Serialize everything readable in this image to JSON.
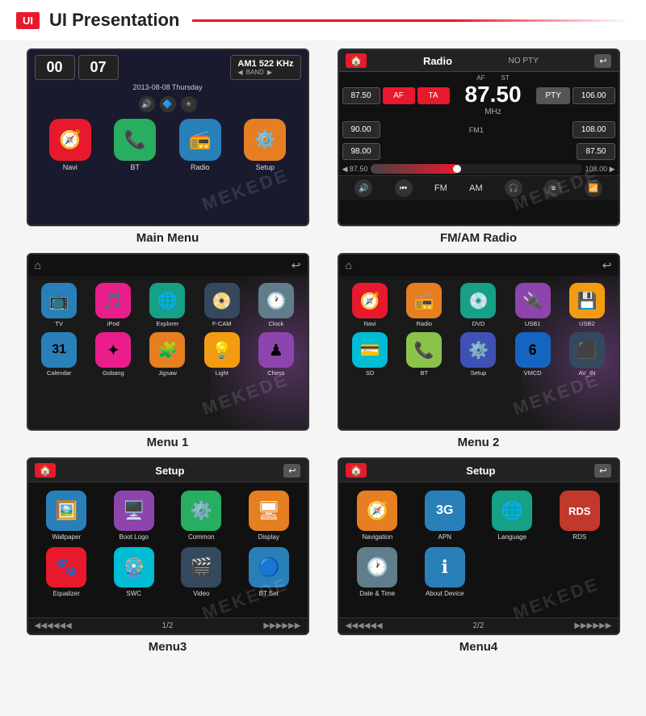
{
  "header": {
    "badge": "UI",
    "title": "UI Presentation"
  },
  "screens": [
    {
      "id": "main-menu",
      "label": "Main Menu",
      "data": {
        "time1": "00",
        "time2": "07",
        "radio_freq": "AM1 522 KHz",
        "band": "BAND",
        "date": "2013-08-08 Thursday",
        "apps": [
          {
            "label": "Navi",
            "icon": "🧭",
            "color": "ic-red"
          },
          {
            "label": "BT",
            "icon": "📞",
            "color": "ic-green"
          },
          {
            "label": "Radio",
            "icon": "📻",
            "color": "ic-blue"
          },
          {
            "label": "Setup",
            "icon": "⚙️",
            "color": "ic-orange"
          }
        ]
      }
    },
    {
      "id": "radio",
      "label": "FM/AM Radio",
      "data": {
        "title": "Radio",
        "no_pty": "NO PTY",
        "freq_main": "87.50",
        "mhz": "MHz",
        "fm1": "FM1",
        "af_label": "AF",
        "st_label": "ST",
        "btns": [
          "87.50",
          "AF",
          "TA",
          "PTY",
          "106.00"
        ],
        "btns2": [
          "90.00",
          "",
          "",
          "",
          "108.00"
        ],
        "btns3": [
          "98.00",
          "",
          "",
          "",
          "87.50"
        ],
        "slider_left": "87.50",
        "slider_right": "108.00",
        "bottom": [
          "FM",
          "AM"
        ]
      }
    },
    {
      "id": "menu1",
      "label": "Menu 1",
      "data": {
        "apps_row1": [
          {
            "label": "TV",
            "icon": "📺",
            "color": "ic-blue"
          },
          {
            "label": "iPod",
            "icon": "🎵",
            "color": "ic-pink"
          },
          {
            "label": "Explorer",
            "icon": "🌐",
            "color": "ic-teal"
          },
          {
            "label": "F-CAM",
            "icon": "📀",
            "color": "ic-dark"
          },
          {
            "label": "Clock",
            "icon": "🕐",
            "color": "ic-gray"
          }
        ],
        "apps_row2": [
          {
            "label": "Calendar",
            "icon": "31",
            "color": "ic-blue"
          },
          {
            "label": "Gobang",
            "icon": "✦",
            "color": "ic-pink"
          },
          {
            "label": "Jigsaw",
            "icon": "🧩",
            "color": "ic-orange"
          },
          {
            "label": "Light",
            "icon": "💡",
            "color": "ic-yellow"
          },
          {
            "label": "Chess",
            "icon": "♟",
            "color": "ic-purple"
          }
        ]
      }
    },
    {
      "id": "menu2",
      "label": "Menu 2",
      "data": {
        "apps_row1": [
          {
            "label": "Navi",
            "icon": "🧭",
            "color": "ic-red"
          },
          {
            "label": "Radio",
            "icon": "📻",
            "color": "ic-orange"
          },
          {
            "label": "DVD",
            "icon": "💿",
            "color": "ic-teal"
          },
          {
            "label": "USB1",
            "icon": "🔌",
            "color": "ic-purple"
          },
          {
            "label": "USB2",
            "icon": "💾",
            "color": "ic-yellow"
          }
        ],
        "apps_row2": [
          {
            "label": "SD",
            "icon": "💳",
            "color": "ic-cyan"
          },
          {
            "label": "BT",
            "icon": "📞",
            "color": "ic-lime"
          },
          {
            "label": "Setup",
            "icon": "⚙️",
            "color": "ic-indigo"
          },
          {
            "label": "VMCD",
            "icon": "6",
            "color": "ic-deepblue"
          },
          {
            "label": "AV_IN",
            "icon": "⬛",
            "color": "ic-dark"
          }
        ]
      }
    },
    {
      "id": "setup1",
      "label": "Menu3",
      "data": {
        "title": "Setup",
        "page": "1/2",
        "apps": [
          {
            "label": "Wallpaper",
            "icon": "🖼️",
            "color": "ic-blue"
          },
          {
            "label": "Boot Logo",
            "icon": "🖥️",
            "color": "ic-purple"
          },
          {
            "label": "Common",
            "icon": "⚙️",
            "color": "ic-green"
          },
          {
            "label": "Display",
            "icon": "🖥",
            "color": "ic-orange"
          },
          {
            "label": "Equalizer",
            "icon": "🐾",
            "color": "ic-red"
          },
          {
            "label": "SWC",
            "icon": "🎡",
            "color": "ic-cyan"
          },
          {
            "label": "Video",
            "icon": "🎬",
            "color": "ic-dark"
          },
          {
            "label": "BT Set",
            "icon": "🔵",
            "color": "ic-blue"
          }
        ]
      }
    },
    {
      "id": "setup2",
      "label": "Menu4",
      "data": {
        "title": "Setup",
        "page": "2/2",
        "apps": [
          {
            "label": "Navigation",
            "icon": "🧭",
            "color": "ic-orange"
          },
          {
            "label": "APN",
            "icon": "3G",
            "color": "ic-blue"
          },
          {
            "label": "Language",
            "icon": "🌐",
            "color": "ic-teal"
          },
          {
            "label": "RDS",
            "icon": "RDS",
            "color": "ic-deepred"
          },
          {
            "label": "Date & Time",
            "icon": "🕐",
            "color": "ic-gray"
          },
          {
            "label": "About Device",
            "icon": "ℹ",
            "color": "ic-blue"
          }
        ]
      }
    }
  ],
  "watermark": "MEKEDE"
}
